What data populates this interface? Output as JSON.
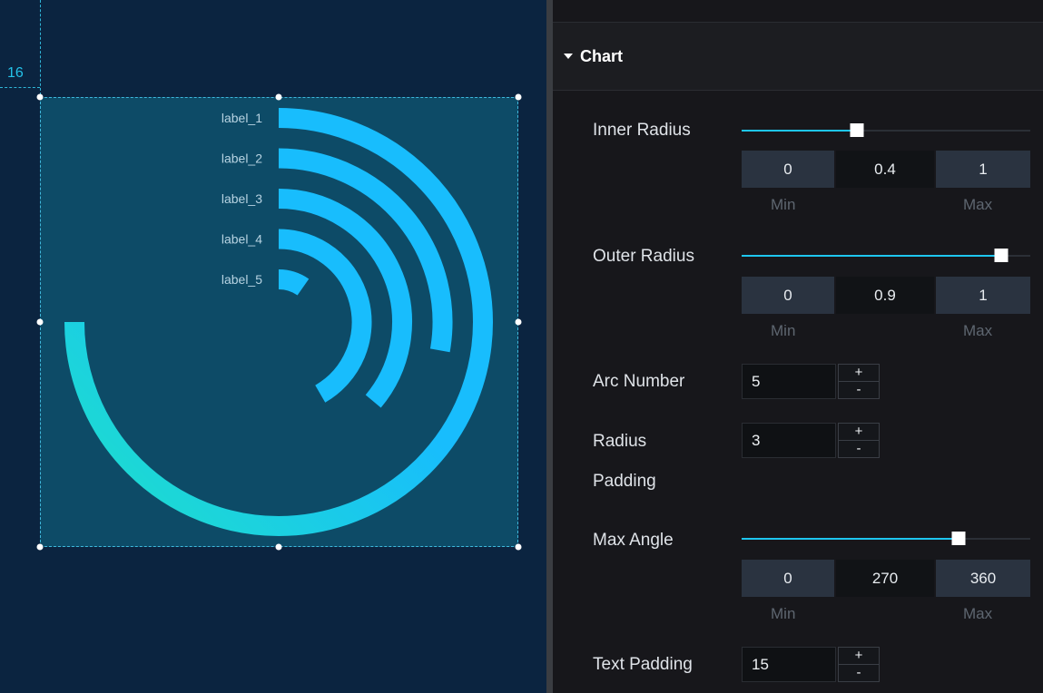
{
  "canvas": {
    "ruler_value": "16",
    "chart_data": {
      "type": "radial-bar",
      "categories": [
        "label_1",
        "label_2",
        "label_3",
        "label_4",
        "label_5"
      ],
      "colors": {
        "bar": "#18bdfd",
        "gradient_start": "#1ee0c9",
        "gradient_end": "#18bdfd"
      }
    }
  },
  "panel": {
    "section_title": "Chart",
    "inner_radius": {
      "label": "Inner Radius",
      "min": "0",
      "value": "0.4",
      "max": "1",
      "min_caption": "Min",
      "max_caption": "Max",
      "fraction": 0.4
    },
    "outer_radius": {
      "label": "Outer Radius",
      "min": "0",
      "value": "0.9",
      "max": "1",
      "min_caption": "Min",
      "max_caption": "Max",
      "fraction": 0.9
    },
    "arc_number": {
      "label": "Arc Number",
      "value": "5",
      "plus": "+",
      "minus": "-"
    },
    "radius_padding": {
      "label_line1": "Radius",
      "label_line2": "Padding",
      "value": "3",
      "plus": "+",
      "minus": "-"
    },
    "max_angle": {
      "label": "Max Angle",
      "min": "0",
      "value": "270",
      "max": "360",
      "min_caption": "Min",
      "max_caption": "Max",
      "fraction": 0.75
    },
    "text_padding": {
      "label": "Text Padding",
      "value": "15",
      "plus": "+",
      "minus": "-"
    }
  },
  "colors": {
    "accent": "#1ec6ef",
    "canvas_bg": "#0b2440",
    "selection_bg": "#0d4b67",
    "panel_bg": "#17171b"
  }
}
